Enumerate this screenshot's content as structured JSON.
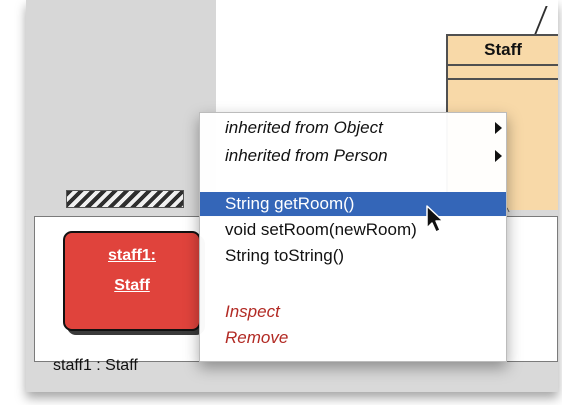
{
  "diagram": {
    "class_name": "Staff"
  },
  "object_bench": {
    "object_line1": "staff1:",
    "object_line2": "Staff",
    "status": "staff1 : Staff"
  },
  "context_menu": {
    "items": [
      {
        "label": "inherited from Object",
        "style": "italic",
        "submenu": true
      },
      {
        "label": "inherited from Person",
        "style": "italic",
        "submenu": true
      },
      {
        "label": "String getRoom()",
        "style": "normal",
        "selected": true
      },
      {
        "label": "void setRoom(newRoom)",
        "style": "normal"
      },
      {
        "label": "String toString()",
        "style": "normal"
      },
      {
        "label": "Inspect",
        "style": "command"
      },
      {
        "label": "Remove",
        "style": "command"
      }
    ]
  },
  "icons": {
    "submenu": "chevron-right-icon",
    "cursor": "mouse-pointer-icon"
  },
  "colors": {
    "object_card": "#e0433c",
    "class_box": "#f8d9a8",
    "selection": "#3466b8",
    "command_text": "#b22a24"
  }
}
